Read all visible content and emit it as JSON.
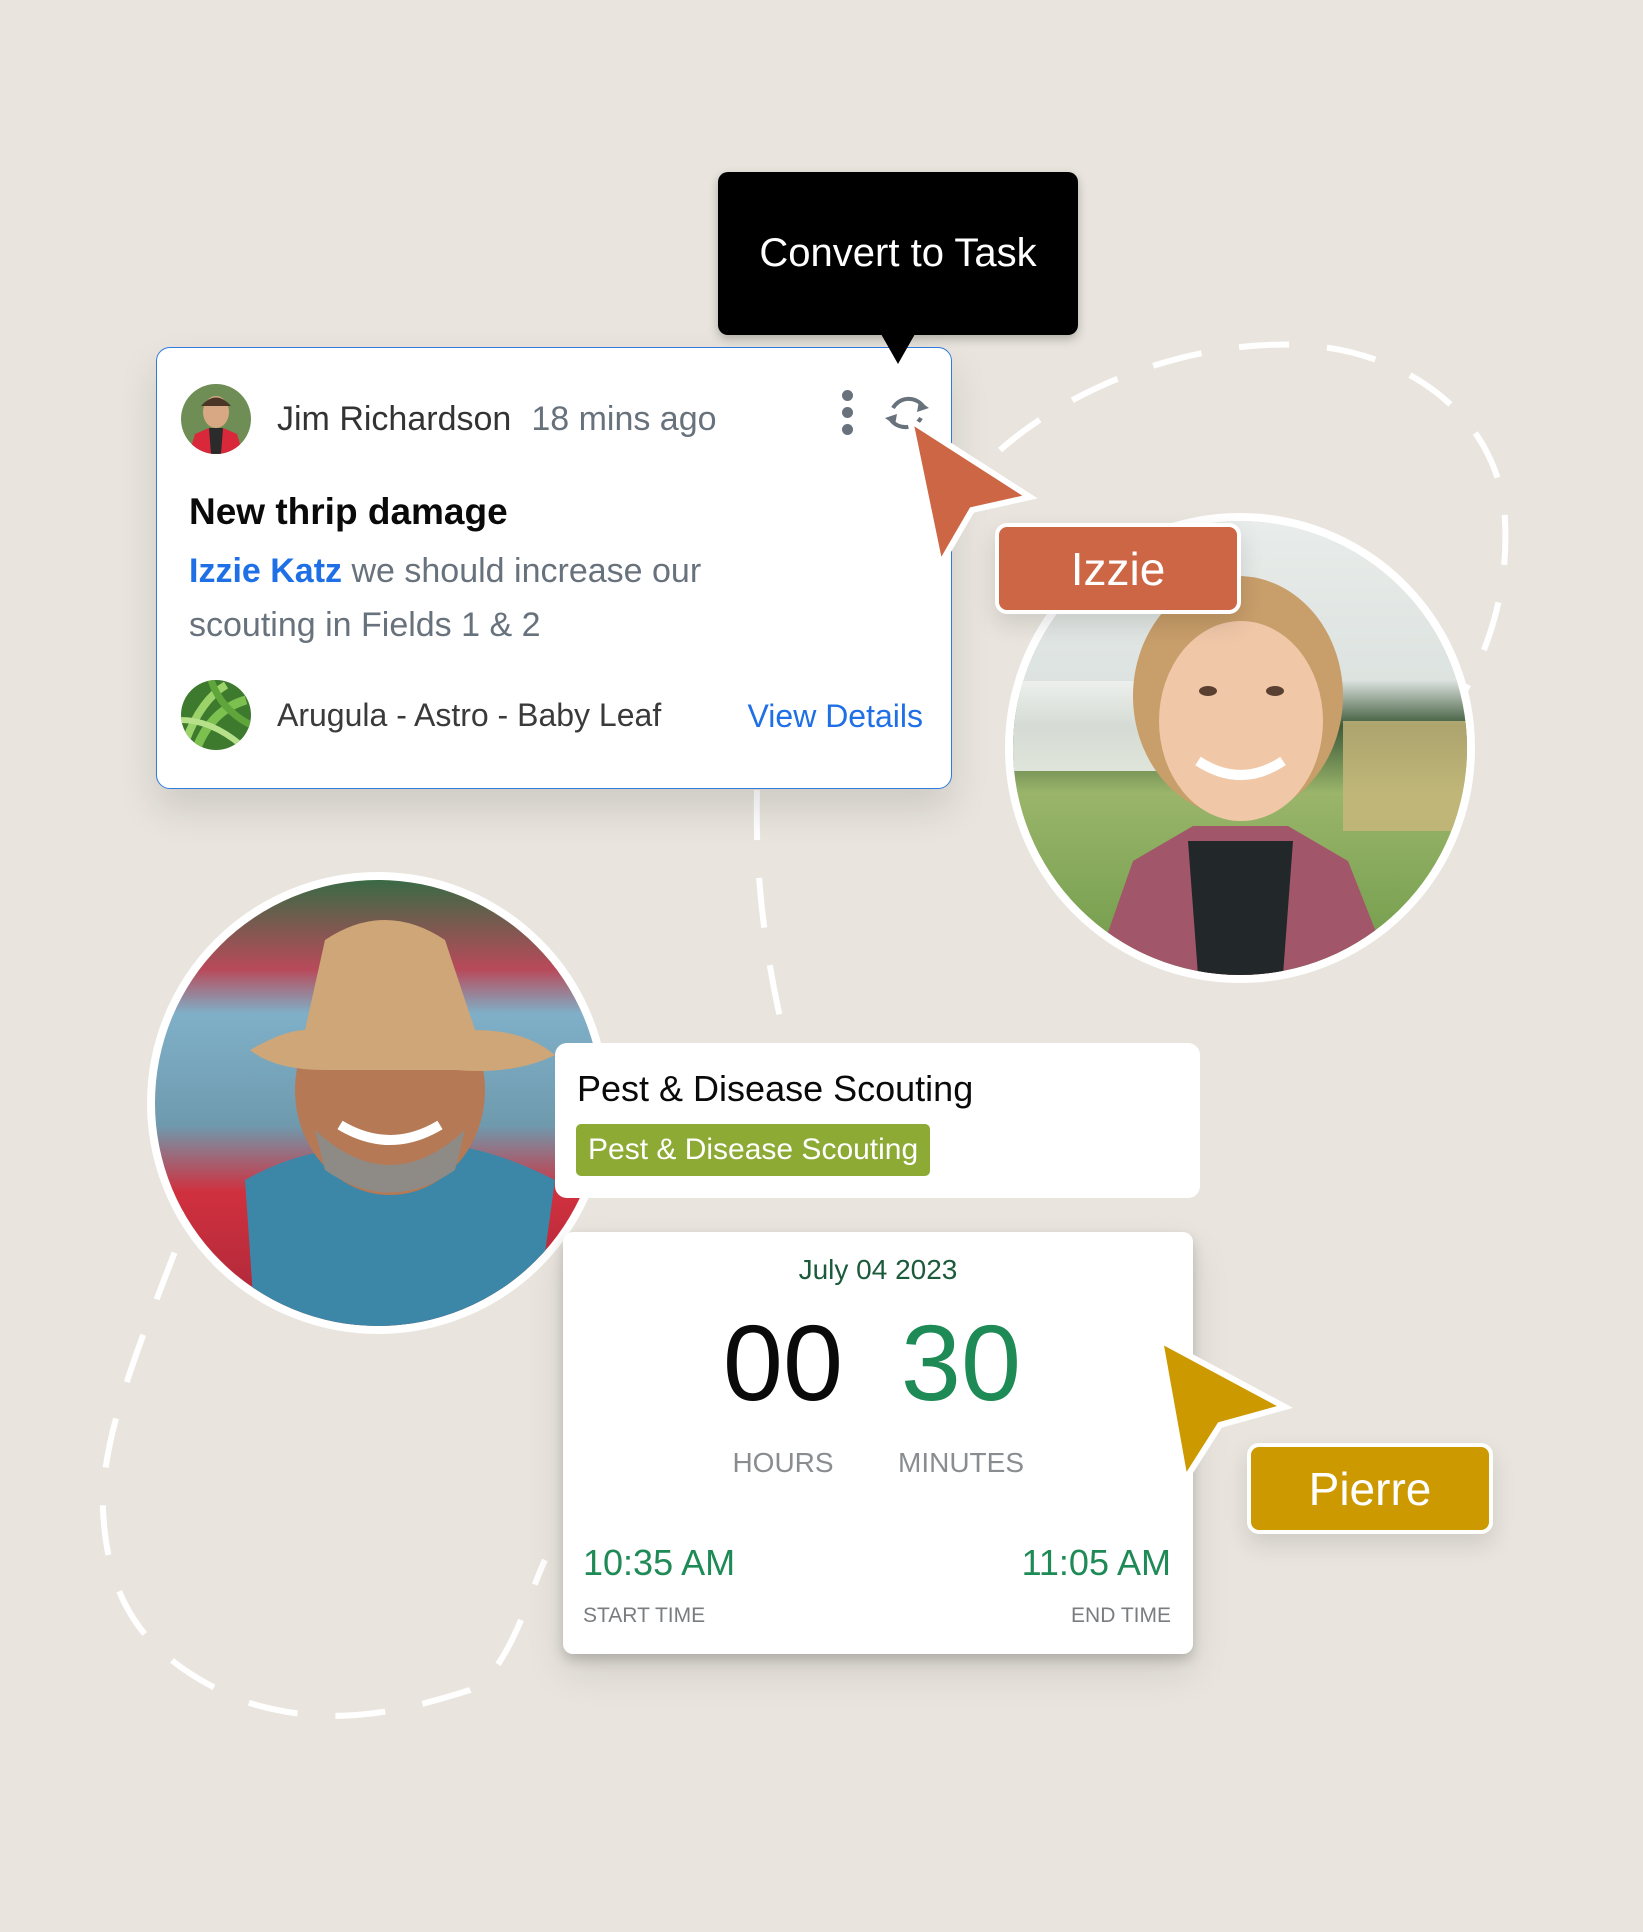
{
  "tooltip": {
    "text": "Convert to Task"
  },
  "comment": {
    "author": "Jim Richardson",
    "time_ago": "18 mins ago",
    "title": "New thrip damage",
    "mention": "Izzie Katz",
    "body": " we should increase our scouting in Fields 1 & 2",
    "crop": "Arugula - Astro - Baby Leaf",
    "view_details": "View Details",
    "icons": {
      "more": "kebab-menu-icon",
      "convert": "convert-refresh-icon"
    }
  },
  "cursors": [
    {
      "name": "Izzie",
      "color": "#CC6644"
    },
    {
      "name": "Pierre",
      "color": "#CC9900"
    }
  ],
  "task": {
    "title": "Pest & Disease Scouting",
    "badge": "Pest & Disease Scouting",
    "badge_color": "#8DAA35"
  },
  "timer": {
    "date": "July 04 2023",
    "hours": "00",
    "minutes": "30",
    "hours_label": "HOURS",
    "minutes_label": "MINUTES",
    "start_time": "10:35 AM",
    "start_label": "START TIME",
    "end_time": "11:05 AM",
    "end_label": "END TIME",
    "accent_color": "#1E8A55"
  },
  "colors": {
    "background": "#E9E5DE",
    "link": "#1F6FE6"
  }
}
